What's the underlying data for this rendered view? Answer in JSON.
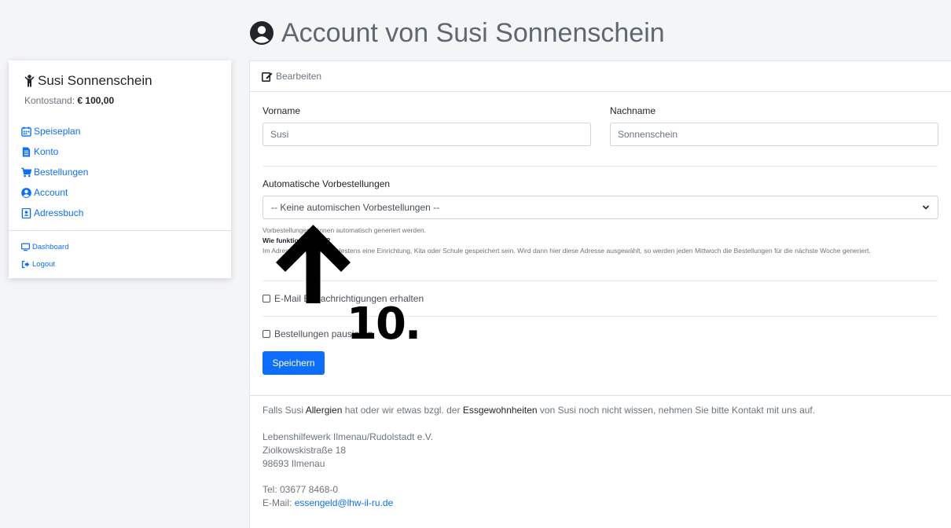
{
  "page": {
    "title": "Account von Susi Sonnenschein"
  },
  "sidebar": {
    "user_name": "Susi Sonnenschein",
    "balance_label": "Kontostand:",
    "balance_value": "€ 100,00",
    "items": [
      {
        "label": "Speiseplan",
        "icon": "calendar-icon"
      },
      {
        "label": "Konto",
        "icon": "document-icon"
      },
      {
        "label": "Bestellungen",
        "icon": "cart-icon"
      },
      {
        "label": "Account",
        "icon": "user-circle-icon"
      },
      {
        "label": "Adressbuch",
        "icon": "address-book-icon"
      }
    ],
    "secondary_items": [
      {
        "label": "Dashboard",
        "icon": "monitor-icon"
      },
      {
        "label": "Logout",
        "icon": "logout-icon"
      }
    ]
  },
  "card": {
    "header": "Bearbeiten",
    "form": {
      "firstname_label": "Vorname",
      "firstname_value": "Susi",
      "lastname_label": "Nachname",
      "lastname_value": "Sonnenschein",
      "preorder_label": "Automatische Vorbestellungen",
      "preorder_selected": "-- Keine automischen Vorbestellungen --",
      "help_line1": "Vorbestellungen können automatisch generiert werden.",
      "help_line2_bold": "Wie funktioniert das?",
      "help_line3": "Im Adressbuch muss mindestens eine Einrichtung, Kita oder Schule gespeichert sein. Wird dann hier diese Adresse ausgewählt, so werden jeden Mittwoch die Bestellungen für die nächste Woche generiert.",
      "email_notify_label": "E-Mail Benachrichtigungen erhalten",
      "pause_orders_label": "Bestellungen pausieren",
      "save_label": "Speichern"
    },
    "footer": {
      "note_pre": "Falls Susi",
      "note_allergies": "Allergien",
      "note_mid": "hat oder wir etwas bzgl. der",
      "note_habits": "Essgewohnheiten",
      "note_post": "von Susi noch nicht wissen, nehmen Sie bitte Kontakt mit uns auf.",
      "org_name": "Lebenshilfewerk Ilmenau/Rudolstadt e.V.",
      "street": "Ziolkowskistraße 18",
      "city": "98693 Ilmenau",
      "phone": "Tel: 03677 8468-0",
      "email_label": "E-Mail:",
      "email": "essengeld@lhw-il-ru.de"
    }
  },
  "annotation": {
    "number": "10."
  }
}
